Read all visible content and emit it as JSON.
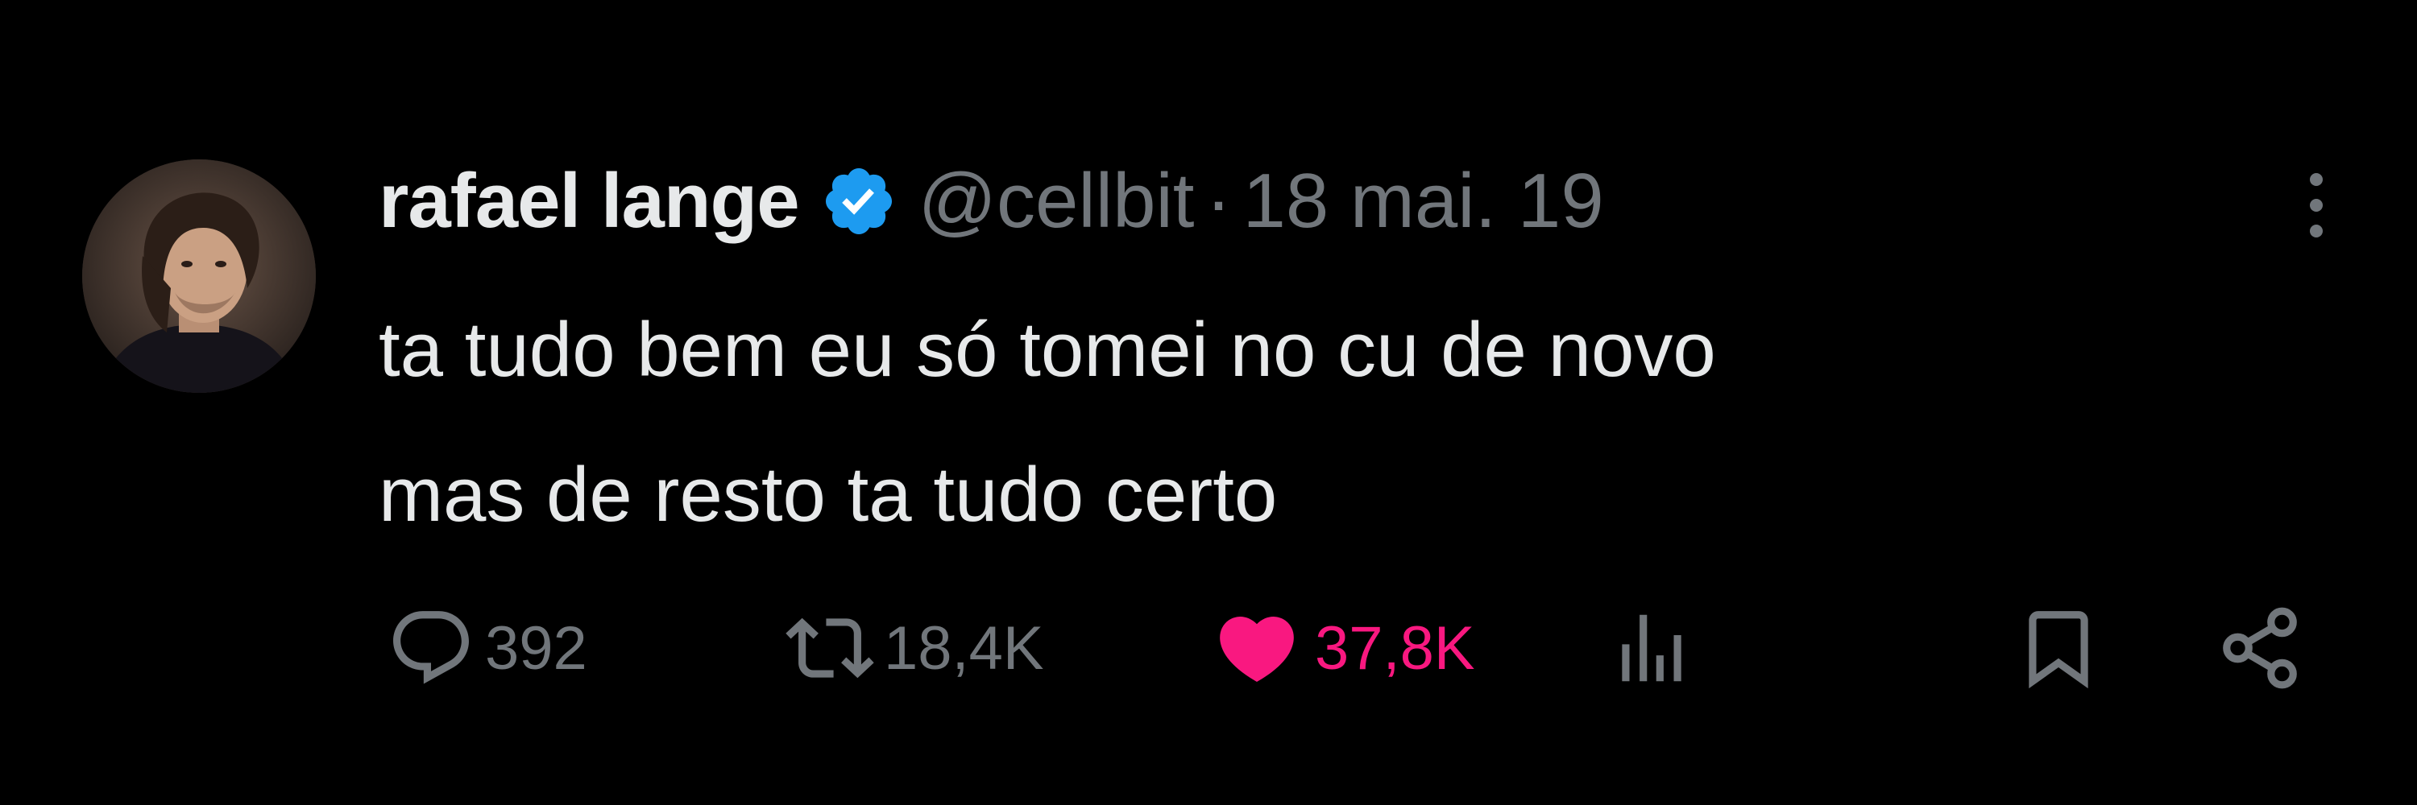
{
  "tweet": {
    "author": {
      "display_name": "rafael lange",
      "handle": "@cellbit",
      "verified": true,
      "avatar_icon": "user-avatar"
    },
    "separator": "·",
    "date": "18 mai. 19",
    "text_lines": [
      "ta tudo bem eu só tomei no cu de novo",
      "mas de resto ta tudo certo"
    ],
    "actions": {
      "replies": {
        "count": "392",
        "icon": "reply-icon"
      },
      "retweets": {
        "count": "18,4K",
        "icon": "retweet-icon"
      },
      "likes": {
        "count": "37,8K",
        "icon": "heart-icon",
        "liked": true
      },
      "views": {
        "icon": "views-icon"
      },
      "bookmark": {
        "icon": "bookmark-icon"
      },
      "share": {
        "icon": "share-icon"
      }
    },
    "more_icon": "more-options-icon"
  },
  "colors": {
    "background": "#000000",
    "primary_text": "#e7e9ea",
    "secondary_text": "#71767b",
    "verified_blue": "#1d9bf0",
    "like_pink": "#f91880"
  }
}
